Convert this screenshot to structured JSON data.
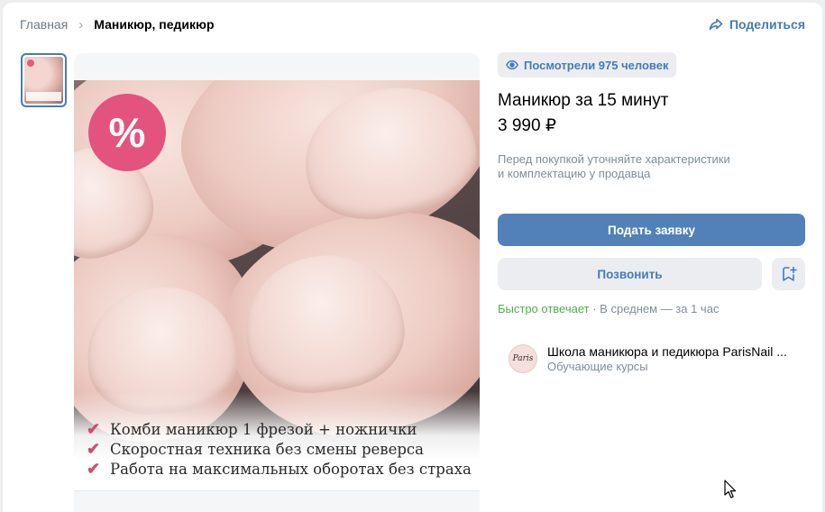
{
  "breadcrumb": {
    "home": "Главная",
    "separator": "›",
    "current": "Маникюр, педикюр"
  },
  "share": {
    "label": "Поделиться",
    "icon": "share-arrow-icon"
  },
  "gallery": {
    "badge": "%",
    "lines": [
      "Комби маникюр 1 фрезой + ножнички",
      "Скоростная техника без смены реверса",
      "Работа на максимальных оборотах без страха"
    ],
    "check_symbol": "✔"
  },
  "product": {
    "views": "Посмотрели 975 человек",
    "title": "Маникюр за 15 минут",
    "price": "3 990 ₽",
    "note_line1": "Перед покупкой уточняйте характеристики",
    "note_line2": "и комплектацию у продавца",
    "apply_label": "Подать заявку",
    "call_label": "Позвонить",
    "response_fast": "Быстро отвечает",
    "response_rest": " · В среднем — за 1 час"
  },
  "seller": {
    "name": "Школа маникюра и педикюра ParisNail ...",
    "subtitle": "Обучающие курсы",
    "avatar_text": "Paris"
  },
  "colors": {
    "accent": "#447bba",
    "primary_button": "#5181b8",
    "badge": "#e3537e",
    "fast_reply": "#4bb34b"
  }
}
